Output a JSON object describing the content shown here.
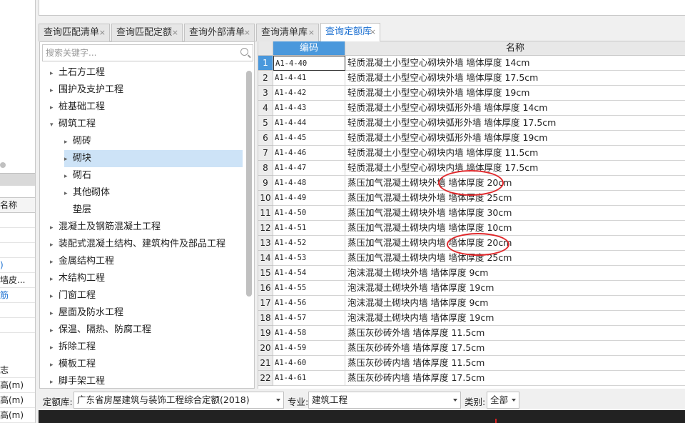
{
  "left_pane": {
    "column_header": "名称",
    "rows": [
      "",
      "",
      "",
      ")",
      "墙皮...",
      "筋",
      "",
      "",
      "志",
      "高(m)",
      "高(m)",
      "高(m)"
    ]
  },
  "tabs": [
    {
      "label": "查询匹配清单",
      "close": "×"
    },
    {
      "label": "查询匹配定额",
      "close": "×"
    },
    {
      "label": "查询外部清单",
      "close": "×"
    },
    {
      "label": "查询清单库",
      "close": "×"
    },
    {
      "label": "查询定额库",
      "close": "×",
      "active": true
    }
  ],
  "search": {
    "placeholder": "搜索关键字..."
  },
  "tree": [
    {
      "label": "土石方工程",
      "level": 0,
      "arrow": "▸"
    },
    {
      "label": "围护及支护工程",
      "level": 0,
      "arrow": "▸"
    },
    {
      "label": "桩基础工程",
      "level": 0,
      "arrow": "▸"
    },
    {
      "label": "砌筑工程",
      "level": 0,
      "arrow": "▾"
    },
    {
      "label": "砌砖",
      "level": 1,
      "arrow": "▸"
    },
    {
      "label": "砌块",
      "level": 1,
      "arrow": "▸",
      "selected": true
    },
    {
      "label": "砌石",
      "level": 1,
      "arrow": "▸"
    },
    {
      "label": "其他砌体",
      "level": 1,
      "arrow": "▸"
    },
    {
      "label": "垫层",
      "level": 1,
      "arrow": ""
    },
    {
      "label": "混凝土及钢筋混凝土工程",
      "level": 0,
      "arrow": "▸"
    },
    {
      "label": "装配式混凝土结构、建筑构件及部品工程",
      "level": 0,
      "arrow": "▸"
    },
    {
      "label": "金属结构工程",
      "level": 0,
      "arrow": "▸"
    },
    {
      "label": "木结构工程",
      "level": 0,
      "arrow": "▸"
    },
    {
      "label": "门窗工程",
      "level": 0,
      "arrow": "▸"
    },
    {
      "label": "屋面及防水工程",
      "level": 0,
      "arrow": "▸"
    },
    {
      "label": "保温、隔热、防腐工程",
      "level": 0,
      "arrow": "▸"
    },
    {
      "label": "拆除工程",
      "level": 0,
      "arrow": "▸"
    },
    {
      "label": "模板工程",
      "level": 0,
      "arrow": "▸"
    },
    {
      "label": "脚手架工程",
      "level": 0,
      "arrow": "▸"
    }
  ],
  "grid": {
    "headers": {
      "code": "编码",
      "name": "名称"
    },
    "rows": [
      {
        "no": "1",
        "code": "A1-4-40",
        "name": "轻质混凝土小型空心砌块外墙 墙体厚度 14cm"
      },
      {
        "no": "2",
        "code": "A1-4-41",
        "name": "轻质混凝土小型空心砌块外墙 墙体厚度 17.5cm"
      },
      {
        "no": "3",
        "code": "A1-4-42",
        "name": "轻质混凝土小型空心砌块外墙 墙体厚度 19cm"
      },
      {
        "no": "4",
        "code": "A1-4-43",
        "name": "轻质混凝土小型空心砌块弧形外墙 墙体厚度 14cm"
      },
      {
        "no": "5",
        "code": "A1-4-44",
        "name": "轻质混凝土小型空心砌块弧形外墙 墙体厚度 17.5cm"
      },
      {
        "no": "6",
        "code": "A1-4-45",
        "name": "轻质混凝土小型空心砌块弧形外墙 墙体厚度 19cm"
      },
      {
        "no": "7",
        "code": "A1-4-46",
        "name": "轻质混凝土小型空心砌块内墙 墙体厚度 11.5cm"
      },
      {
        "no": "8",
        "code": "A1-4-47",
        "name": "轻质混凝土小型空心砌块内墙 墙体厚度 17.5cm"
      },
      {
        "no": "9",
        "code": "A1-4-48",
        "name": "蒸压加气混凝土砌块外墙 墙体厚度 20cm"
      },
      {
        "no": "10",
        "code": "A1-4-49",
        "name": "蒸压加气混凝土砌块外墙 墙体厚度 25cm"
      },
      {
        "no": "11",
        "code": "A1-4-50",
        "name": "蒸压加气混凝土砌块外墙 墙体厚度 30cm"
      },
      {
        "no": "12",
        "code": "A1-4-51",
        "name": "蒸压加气混凝土砌块内墙 墙体厚度 10cm"
      },
      {
        "no": "13",
        "code": "A1-4-52",
        "name": "蒸压加气混凝土砌块内墙 墙体厚度 20cm"
      },
      {
        "no": "14",
        "code": "A1-4-53",
        "name": "蒸压加气混凝土砌块内墙 墙体厚度 25cm"
      },
      {
        "no": "15",
        "code": "A1-4-54",
        "name": "泡沫混凝土砌块外墙 墙体厚度 9cm"
      },
      {
        "no": "16",
        "code": "A1-4-55",
        "name": "泡沫混凝土砌块外墙 墙体厚度 19cm"
      },
      {
        "no": "17",
        "code": "A1-4-56",
        "name": "泡沫混凝土砌块内墙 墙体厚度 9cm"
      },
      {
        "no": "18",
        "code": "A1-4-57",
        "name": "泡沫混凝土砌块内墙 墙体厚度 19cm"
      },
      {
        "no": "19",
        "code": "A1-4-58",
        "name": "蒸压灰砂砖外墙 墙体厚度 11.5cm"
      },
      {
        "no": "20",
        "code": "A1-4-59",
        "name": "蒸压灰砂砖外墙 墙体厚度 17.5cm"
      },
      {
        "no": "21",
        "code": "A1-4-60",
        "name": "蒸压灰砂砖内墙 墙体厚度 11.5cm"
      },
      {
        "no": "22",
        "code": "A1-4-61",
        "name": "蒸压灰砂砖内墙 墙体厚度 17.5cm"
      }
    ]
  },
  "filters": {
    "quota_label": "定额库:",
    "quota_value": "广东省房屋建筑与装饰工程综合定额(2018)",
    "major_label": "专业:",
    "major_value": "建筑工程",
    "category_label": "类别:",
    "category_value": "全部"
  },
  "colors": {
    "accent": "#4a98dc",
    "annotation": "#e0282b",
    "selected_tree": "#cde3f7"
  }
}
